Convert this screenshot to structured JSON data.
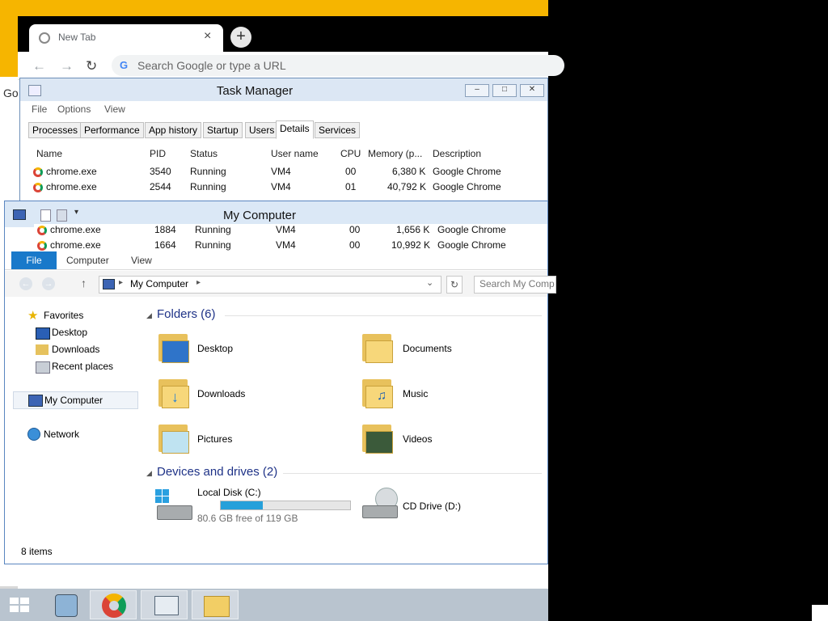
{
  "chrome": {
    "tab_title": "New Tab",
    "tab_close": "×",
    "new_tab": "+",
    "omnibox_placeholder": "Search Google or type a URL",
    "side_text": "Go"
  },
  "task_manager": {
    "title": "Task Manager",
    "menu": [
      "File",
      "Options",
      "View"
    ],
    "tabs": [
      "Processes",
      "Performance",
      "App history",
      "Startup",
      "Users",
      "Details",
      "Services"
    ],
    "active_tab": "Details",
    "columns": [
      "Name",
      "PID",
      "Status",
      "User name",
      "CPU",
      "Memory (p...",
      "Description"
    ],
    "rows": [
      {
        "name": "chrome.exe",
        "pid": "3540",
        "status": "Running",
        "user": "VM4",
        "cpu": "00",
        "memory": "6,380 K",
        "description": "Google Chrome"
      },
      {
        "name": "chrome.exe",
        "pid": "2544",
        "status": "Running",
        "user": "VM4",
        "cpu": "01",
        "memory": "40,792 K",
        "description": "Google Chrome"
      },
      {
        "name": "chrome.exe",
        "pid": "1884",
        "status": "Running",
        "user": "VM4",
        "cpu": "00",
        "memory": "1,656 K",
        "description": "Google Chrome"
      },
      {
        "name": "chrome.exe",
        "pid": "1664",
        "status": "Running",
        "user": "VM4",
        "cpu": "00",
        "memory": "10,992 K",
        "description": "Google Chrome"
      }
    ]
  },
  "explorer": {
    "title": "My Computer",
    "ribbon": {
      "file": "File",
      "computer": "Computer",
      "view": "View"
    },
    "address": "My Computer",
    "search_placeholder": "Search My Comp",
    "nav": {
      "favorites": "Favorites",
      "desktop": "Desktop",
      "downloads": "Downloads",
      "recent": "Recent places",
      "my_computer": "My Computer",
      "network": "Network"
    },
    "folders_header": "Folders (6)",
    "folders": [
      "Desktop",
      "Documents",
      "Downloads",
      "Music",
      "Pictures",
      "Videos"
    ],
    "devices_header": "Devices and drives (2)",
    "local_disk": {
      "name": "Local Disk (C:)",
      "free_text": "80.6 GB free of 119 GB",
      "used_fraction": 0.323
    },
    "cd_drive": "CD Drive (D:)",
    "status": "8 items"
  }
}
